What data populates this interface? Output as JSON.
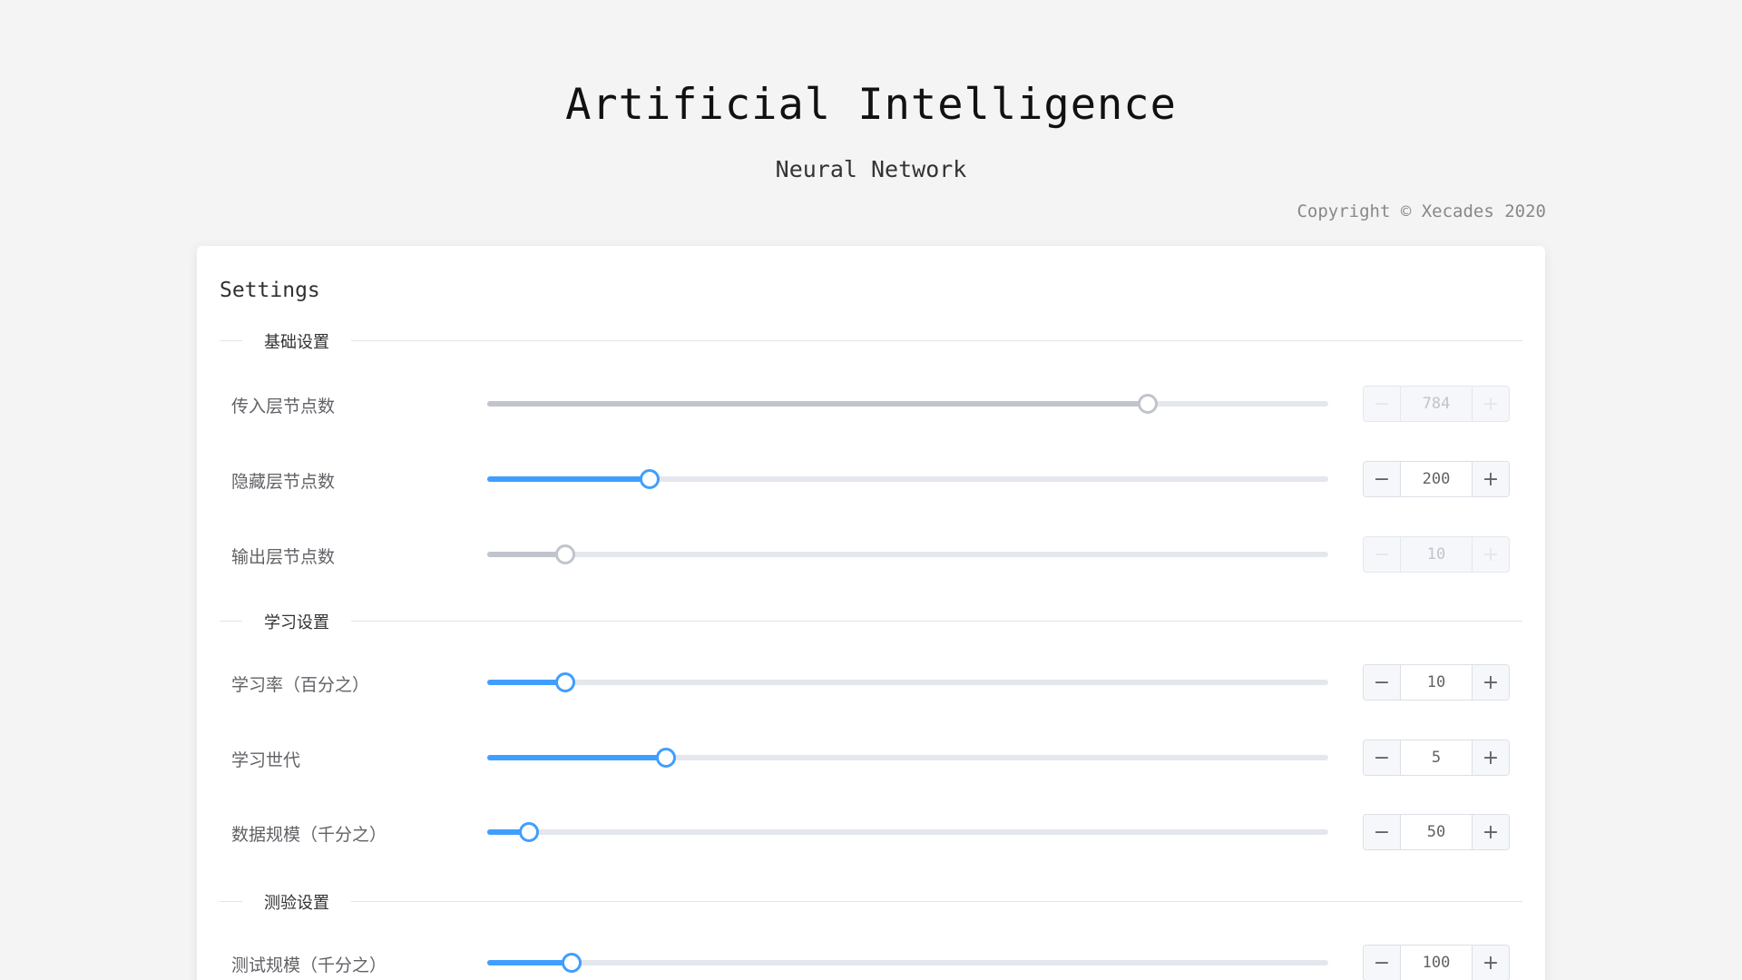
{
  "header": {
    "title": "Artificial Intelligence",
    "subtitle": "Neural Network",
    "copyright": "Copyright © Xecades 2020"
  },
  "settings": {
    "title": "Settings",
    "sections": [
      {
        "label": "基础设置",
        "rows": [
          {
            "label": "传入层节点数",
            "value": "784",
            "fraction": 0.785,
            "disabled": true
          },
          {
            "label": "隐藏层节点数",
            "value": "200",
            "fraction": 0.193,
            "disabled": false
          },
          {
            "label": "输出层节点数",
            "value": "10",
            "fraction": 0.093,
            "disabled": true
          }
        ]
      },
      {
        "label": "学习设置",
        "rows": [
          {
            "label": "学习率（百分之）",
            "value": "10",
            "fraction": 0.093,
            "disabled": false
          },
          {
            "label": "学习世代",
            "value": "5",
            "fraction": 0.212,
            "disabled": false
          },
          {
            "label": "数据规模（千分之）",
            "value": "50",
            "fraction": 0.05,
            "disabled": false
          }
        ]
      },
      {
        "label": "测验设置",
        "rows": [
          {
            "label": "测试规模（千分之）",
            "value": "100",
            "fraction": 0.1,
            "disabled": false
          }
        ]
      }
    ],
    "minus_icon": "minus-icon",
    "plus_icon": "plus-icon"
  },
  "colors": {
    "accent": "#409eff",
    "disabled": "#c0c4cc"
  }
}
